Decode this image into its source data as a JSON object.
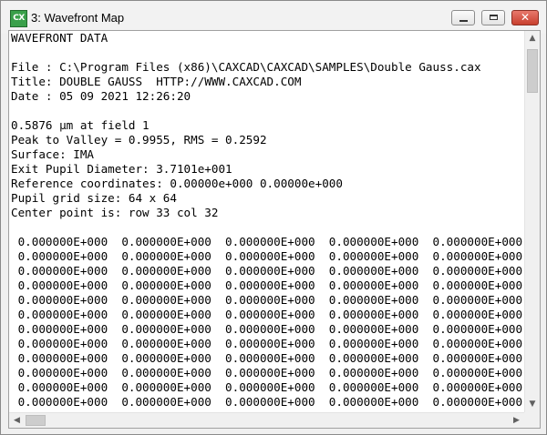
{
  "window": {
    "title": "3: Wavefront Map",
    "icon_text": "CX",
    "close_glyph": "✕"
  },
  "header_lines": [
    "WAVEFRONT DATA",
    "",
    "File : C:\\Program Files (x86)\\CAXCAD\\CAXCAD\\SAMPLES\\Double Gauss.cax",
    "Title: DOUBLE GAUSS  HTTP://WWW.CAXCAD.COM",
    "Date : 05 09 2021 12:26:20",
    "",
    "0.5876 µm at field 1",
    "Peak to Valley = 0.9955, RMS = 0.2592",
    "Surface: IMA",
    "Exit Pupil Diameter: 3.7101e+001",
    "Reference coordinates: 0.00000e+000 0.00000e+000",
    "Pupil grid size: 64 x 64",
    "Center point is: row 33 col 32",
    ""
  ],
  "data_rows": [
    " 0.000000E+000  0.000000E+000  0.000000E+000  0.000000E+000  0.000000E+000",
    " 0.000000E+000  0.000000E+000  0.000000E+000  0.000000E+000  0.000000E+000",
    " 0.000000E+000  0.000000E+000  0.000000E+000  0.000000E+000  0.000000E+000",
    " 0.000000E+000  0.000000E+000  0.000000E+000  0.000000E+000  0.000000E+000",
    " 0.000000E+000  0.000000E+000  0.000000E+000  0.000000E+000  0.000000E+000",
    " 0.000000E+000  0.000000E+000  0.000000E+000  0.000000E+000  0.000000E+000",
    " 0.000000E+000  0.000000E+000  0.000000E+000  0.000000E+000  0.000000E+000",
    " 0.000000E+000  0.000000E+000  0.000000E+000  0.000000E+000  0.000000E+000",
    " 0.000000E+000  0.000000E+000  0.000000E+000  0.000000E+000  0.000000E+000",
    " 0.000000E+000  0.000000E+000  0.000000E+000  0.000000E+000  0.000000E+000",
    " 0.000000E+000  0.000000E+000  0.000000E+000  0.000000E+000  0.000000E+000",
    " 0.000000E+000  0.000000E+000  0.000000E+000  0.000000E+000  0.000000E+000"
  ],
  "scroll_glyphs": {
    "up": "▲",
    "down": "▼",
    "left": "◀",
    "right": "▶"
  }
}
